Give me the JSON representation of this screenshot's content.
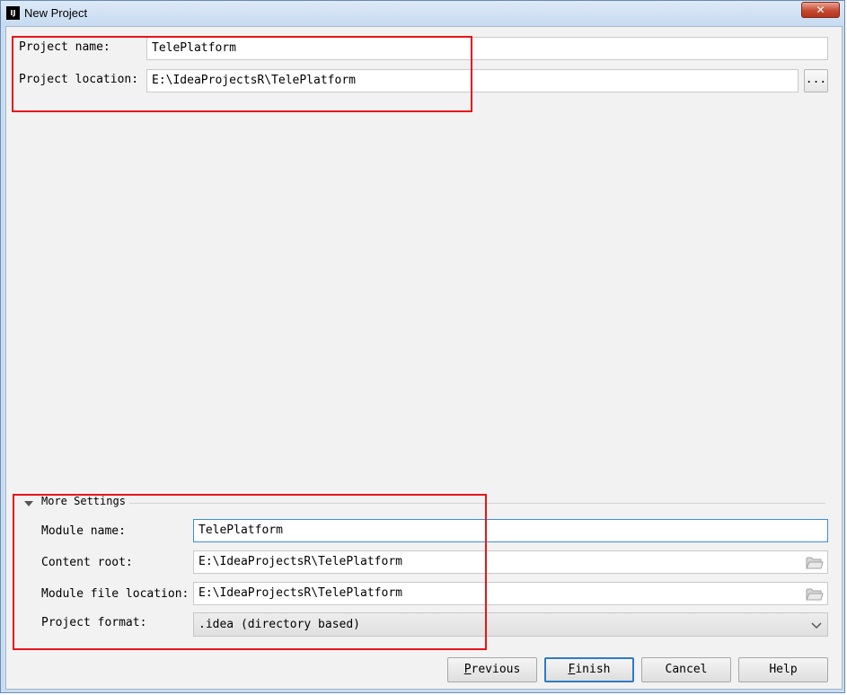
{
  "window": {
    "title": "New Project",
    "app_icon_text": "IJ",
    "close_glyph": "✕"
  },
  "project": {
    "name_label": "Project name:",
    "name_value": "TelePlatform",
    "location_label": "Project location:",
    "location_value": "E:\\IdeaProjectsR\\TelePlatform",
    "browse_label": "..."
  },
  "more_settings": {
    "title": "More Settings",
    "expanded": true,
    "module_name_label": "Module name:",
    "module_name_value": "TelePlatform",
    "content_root_label": "Content root:",
    "content_root_value": "E:\\IdeaProjectsR\\TelePlatform",
    "module_file_label": "Module file location:",
    "module_file_value": "E:\\IdeaProjectsR\\TelePlatform",
    "project_format_label": "Project format:",
    "project_format_value": ".idea (directory based)"
  },
  "buttons": {
    "previous": {
      "mnemonic": "P",
      "rest": "revious"
    },
    "finish": {
      "mnemonic": "F",
      "rest": "inish"
    },
    "cancel": "Cancel",
    "help": "Help"
  },
  "icons": {
    "folder": "folder-icon",
    "expand": "triangle-down-icon",
    "dropdown": "chevron-down-icon"
  },
  "colors": {
    "highlight_box": "#e8141b",
    "focus_border": "#3d8ed5",
    "default_button_border": "#2f7bc4"
  }
}
